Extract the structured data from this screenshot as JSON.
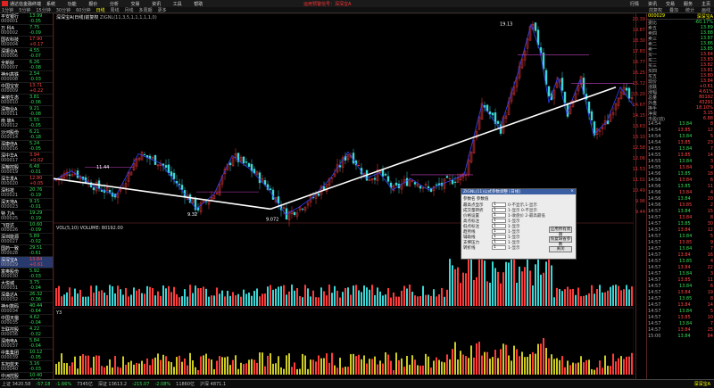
{
  "window": {
    "app_title": "通达信金融终端",
    "menu": [
      "系统",
      "功能",
      "报价",
      "分析",
      "交易",
      "资讯",
      "工具",
      "帮助"
    ],
    "alert": "运用预警信号：深深宝A",
    "right_items": [
      "行情",
      "资讯",
      "交易",
      "服务",
      "主页"
    ]
  },
  "toolbar": {
    "items": [
      "1分钟",
      "5分钟",
      "15分钟",
      "30分钟",
      "60分钟",
      "日线",
      "周线",
      "月线",
      "多周期",
      "更多"
    ],
    "selected": "日线",
    "right": [
      "前复权",
      "叠加",
      "统计",
      "画线"
    ]
  },
  "stocks": [
    {
      "name": "平安银行",
      "code": "000001",
      "price": "13.99",
      "chg": "-0.05",
      "pct": "-0.36%",
      "up": false
    },
    {
      "name": "万 科A",
      "code": "000002",
      "price": "7.75",
      "chg": "-0.09",
      "pct": "-1.15%",
      "up": false
    },
    {
      "name": "国农科技",
      "code": "000004",
      "price": "17.90",
      "chg": "+0.17",
      "pct": "+0.96%",
      "up": true
    },
    {
      "name": "深振业A",
      "code": "000006",
      "price": "4.55",
      "chg": "-0.07",
      "pct": "-1.52%",
      "up": false
    },
    {
      "name": "全新好",
      "code": "000007",
      "price": "6.26",
      "chg": "-0.08",
      "pct": "-1.26%",
      "up": false
    },
    {
      "name": "神州高铁",
      "code": "000008",
      "price": "2.54",
      "chg": "-0.03",
      "pct": "-1.17%",
      "up": false
    },
    {
      "name": "中国宝安",
      "code": "000009",
      "price": "13.71",
      "chg": "+0.22",
      "pct": "+1.63%",
      "up": true
    },
    {
      "name": "美丽生态",
      "code": "000010",
      "price": "3.81",
      "chg": "-0.06",
      "pct": "-1.55%",
      "up": false
    },
    {
      "name": "深物业A",
      "code": "000011",
      "price": "9.21",
      "chg": "-0.08",
      "pct": "-0.86%",
      "up": false
    },
    {
      "name": "南 玻A",
      "code": "000012",
      "price": "5.55",
      "chg": "-0.05",
      "pct": "-0.89%",
      "up": false
    },
    {
      "name": "沙河股份",
      "code": "000014",
      "price": "6.21",
      "chg": "-0.18",
      "pct": "-2.82%",
      "up": false
    },
    {
      "name": "深康佳A",
      "code": "000016",
      "price": "5.24",
      "chg": "-0.05",
      "pct": "-0.95%",
      "up": false
    },
    {
      "name": "深中华A",
      "code": "000017",
      "price": "3.94",
      "chg": "+0.02",
      "pct": "+0.51%",
      "up": true
    },
    {
      "name": "深粮控股",
      "code": "000019",
      "price": "6.48",
      "chg": "-0.01",
      "pct": "-0.15%",
      "up": false
    },
    {
      "name": "深华发A",
      "code": "000020",
      "price": "12.80",
      "chg": "+0.05",
      "pct": "+0.39%",
      "up": true
    },
    {
      "name": "深科技",
      "code": "000021",
      "price": "20.76",
      "chg": "-0.19",
      "pct": "-0.91%",
      "up": false
    },
    {
      "name": "深天地A",
      "code": "000023",
      "price": "9.15",
      "chg": "-0.01",
      "pct": "-0.11%",
      "up": false
    },
    {
      "name": "特 力A",
      "code": "000025",
      "price": "19.29",
      "chg": "-0.19",
      "pct": "-0.98%",
      "up": false
    },
    {
      "name": "飞亚达",
      "code": "000026",
      "price": "10.60",
      "chg": "-0.09",
      "pct": "-0.84%",
      "up": false
    },
    {
      "name": "深圳能源",
      "code": "000027",
      "price": "5.89",
      "chg": "-0.02",
      "pct": "-0.34%",
      "up": false
    },
    {
      "name": "国药一致",
      "code": "000028",
      "price": "29.51",
      "chg": "-0.61",
      "pct": "-2.03%",
      "up": false
    },
    {
      "name": "深深宝A",
      "code": "000029",
      "price": "13.84",
      "chg": "+0.61",
      "pct": "+4.61%",
      "up": true,
      "highlight": true
    },
    {
      "name": "富奥股份",
      "code": "000030",
      "price": "5.92",
      "chg": "-0.03",
      "pct": "-0.50%",
      "up": false
    },
    {
      "name": "大悦城",
      "code": "000031",
      "price": "3.75",
      "chg": "-0.04",
      "pct": "-1.06%",
      "up": false
    },
    {
      "name": "深桑达A",
      "code": "000032",
      "price": "26.32",
      "chg": "-0.36",
      "pct": "-1.35%",
      "up": false
    },
    {
      "name": "神州数码",
      "code": "000034",
      "price": "40.44",
      "chg": "-0.64",
      "pct": "-1.56%",
      "up": false
    },
    {
      "name": "中国天楹",
      "code": "000035",
      "price": "4.62",
      "chg": "-0.04",
      "pct": "-0.86%",
      "up": false
    },
    {
      "name": "华联控股",
      "code": "000036",
      "price": "4.22",
      "chg": "-0.02",
      "pct": "-0.47%",
      "up": false
    },
    {
      "name": "深南电A",
      "code": "000037",
      "price": "5.84",
      "chg": "-0.04",
      "pct": "-0.68%",
      "up": false
    },
    {
      "name": "中集集团",
      "code": "000039",
      "price": "10.12",
      "chg": "-0.05",
      "pct": "-0.49%",
      "up": false
    },
    {
      "name": "东旭蓝天",
      "code": "000040",
      "price": "3.16",
      "chg": "-0.03",
      "pct": "-0.94%",
      "up": false
    },
    {
      "name": "中洲控股",
      "code": "000042",
      "price": "10.40",
      "chg": "-0.13",
      "pct": "-1.23%",
      "up": false
    }
  ],
  "chart": {
    "header_code": "深深宝A(日线)前复权",
    "header_params": "ZIGNL(11,3,5,1,1,1,1,1,0)",
    "label_hi": "19.13",
    "label_lo": "9.072",
    "label_mid": "11.44",
    "label_low2": "9.32",
    "vol_header": "VOL(5,10)  VOLUME: 80192.00",
    "macd_header": "Y3",
    "ylabels": [
      "20.39",
      "19.87",
      "18.30",
      "17.83",
      "16.77",
      "16.25",
      "15.72",
      "15.20",
      "14.67",
      "14.15",
      "13.63",
      "13.10",
      "12.58",
      "12.06",
      "11.53",
      "11.01",
      "10.49",
      "9.96",
      "9.44"
    ]
  },
  "chart_data": {
    "type": "line",
    "ylim": [
      8.9,
      19.3
    ],
    "x": [
      0,
      20,
      45,
      70,
      95,
      120,
      140,
      160,
      180,
      200,
      220,
      240,
      260,
      275,
      290,
      310,
      330,
      350,
      365,
      380,
      400,
      420,
      440,
      460,
      480,
      500,
      520,
      535,
      545,
      555,
      565,
      575,
      590,
      605,
      620,
      635,
      650
    ],
    "close": [
      10.9,
      11.4,
      10.6,
      10.1,
      12.3,
      11.8,
      10.6,
      9.4,
      10.2,
      12.2,
      11.5,
      10.5,
      9.1,
      9.5,
      10.0,
      11.0,
      12.4,
      11.0,
      11.3,
      10.4,
      11.0,
      10.4,
      10.8,
      11.2,
      14.9,
      13.6,
      16.5,
      19.1,
      17.7,
      15.0,
      16.3,
      14.4,
      16.2,
      13.3,
      14.0,
      15.8,
      14.8
    ]
  },
  "right_panel": {
    "code": "000029",
    "name": "深深宝A",
    "quotes": [
      {
        "k": "委比",
        "v": "-60.17%"
      },
      {
        "k": "卖五",
        "v": "13.89"
      },
      {
        "k": "卖四",
        "v": "13.88"
      },
      {
        "k": "卖三",
        "v": "13.87"
      },
      {
        "k": "卖二",
        "v": "13.86"
      },
      {
        "k": "卖一",
        "v": "13.85"
      },
      {
        "k": "买一",
        "v": "13.84"
      },
      {
        "k": "买二",
        "v": "13.83"
      },
      {
        "k": "买三",
        "v": "13.82"
      },
      {
        "k": "买四",
        "v": "13.81"
      },
      {
        "k": "买五",
        "v": "13.80"
      },
      {
        "k": "现价",
        "v": "13.84"
      },
      {
        "k": "涨跌",
        "v": "+0.61"
      },
      {
        "k": "涨幅",
        "v": "4.61%"
      },
      {
        "k": "总量",
        "v": "80192"
      },
      {
        "k": "外盘",
        "v": "43291"
      },
      {
        "k": "换手",
        "v": "18.10%"
      },
      {
        "k": "净资",
        "v": "3.15"
      },
      {
        "k": "市盈(动)",
        "v": "6.88"
      }
    ],
    "ticks": [
      {
        "t": "14:54",
        "p": "13.84",
        "v": "8"
      },
      {
        "t": "14:54",
        "p": "13.85",
        "v": "12"
      },
      {
        "t": "14:54",
        "p": "13.84",
        "v": "5"
      },
      {
        "t": "14:54",
        "p": "13.85",
        "v": "23"
      },
      {
        "t": "14:55",
        "p": "13.84",
        "v": "7"
      },
      {
        "t": "14:55",
        "p": "13.85",
        "v": "14"
      },
      {
        "t": "14:55",
        "p": "13.84",
        "v": "3"
      },
      {
        "t": "14:55",
        "p": "13.84",
        "v": "9"
      },
      {
        "t": "14:56",
        "p": "13.85",
        "v": "18"
      },
      {
        "t": "14:56",
        "p": "13.84",
        "v": "6"
      },
      {
        "t": "14:56",
        "p": "13.85",
        "v": "11"
      },
      {
        "t": "14:56",
        "p": "13.84",
        "v": "4"
      },
      {
        "t": "14:56",
        "p": "13.84",
        "v": "20"
      },
      {
        "t": "14:56",
        "p": "13.85",
        "v": "2"
      },
      {
        "t": "14:57",
        "p": "13.84",
        "v": "15"
      },
      {
        "t": "14:57",
        "p": "13.84",
        "v": "8"
      },
      {
        "t": "14:57",
        "p": "13.85",
        "v": "30"
      },
      {
        "t": "14:57",
        "p": "13.84",
        "v": "12"
      },
      {
        "t": "14:57",
        "p": "13.84",
        "v": "5"
      },
      {
        "t": "14:57",
        "p": "13.85",
        "v": "9"
      },
      {
        "t": "14:57",
        "p": "13.84",
        "v": "7"
      },
      {
        "t": "14:57",
        "p": "13.84",
        "v": "16"
      },
      {
        "t": "14:57",
        "p": "13.85",
        "v": "4"
      },
      {
        "t": "14:57",
        "p": "13.84",
        "v": "22"
      },
      {
        "t": "14:57",
        "p": "13.84",
        "v": "3"
      },
      {
        "t": "14:57",
        "p": "13.85",
        "v": "11"
      },
      {
        "t": "14:57",
        "p": "13.84",
        "v": "6"
      },
      {
        "t": "14:57",
        "p": "13.84",
        "v": "19"
      },
      {
        "t": "14:57",
        "p": "13.85",
        "v": "8"
      },
      {
        "t": "14:57",
        "p": "13.84",
        "v": "14"
      },
      {
        "t": "14:57",
        "p": "13.84",
        "v": "5"
      },
      {
        "t": "14:57",
        "p": "13.85",
        "v": "10"
      },
      {
        "t": "14:57",
        "p": "13.84",
        "v": "7"
      },
      {
        "t": "14:57",
        "p": "13.84",
        "v": "25"
      },
      {
        "t": "15:00",
        "p": "13.84",
        "v": "84"
      }
    ]
  },
  "dialog": {
    "title": "ZIGNL(11)公式参数调整 [日线]",
    "header": "参数名  参数值",
    "rows": [
      {
        "k": "最高点显示",
        "v": "1",
        "n": "0-不显示,1-显示"
      },
      {
        "k": "成交量转折",
        "v": "1",
        "n": "1-显示 0-不显示"
      },
      {
        "k": "价格设置",
        "v": "1",
        "n": "1-收盘价 2-最高最低"
      },
      {
        "k": "高点标注",
        "v": "1",
        "n": "1-显示"
      },
      {
        "k": "低点标注",
        "v": "1",
        "n": "1-显示"
      },
      {
        "k": "趋势线",
        "v": "1",
        "n": "1-显示"
      },
      {
        "k": "辅助线",
        "v": "1",
        "n": "1-显示"
      },
      {
        "k": "支撑压力",
        "v": "1",
        "n": "1-显示"
      },
      {
        "k": "转折线",
        "v": "1",
        "n": "1-显示"
      }
    ],
    "buttons": [
      "应用所有周期",
      "恢复缺省参数",
      "关闭"
    ]
  },
  "status": {
    "items": [
      "上证 3420.58",
      "-57.18",
      "-1.66%",
      "7345亿",
      "深证 13613.2",
      "-215.07",
      "-2.08%",
      "11860亿",
      "沪深 4871.1"
    ],
    "right": "深深宝A"
  }
}
